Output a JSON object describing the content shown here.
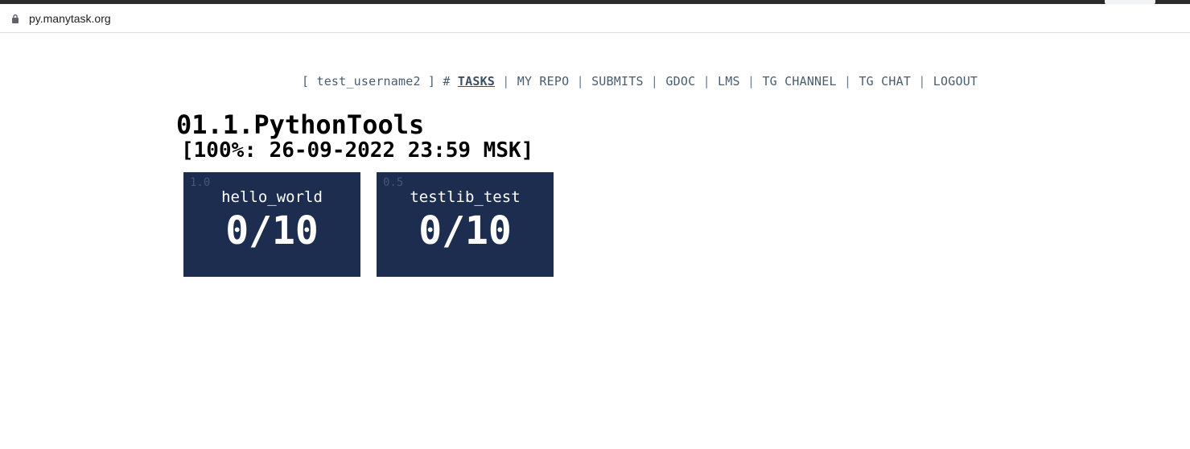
{
  "browser": {
    "url": "py.manytask.org"
  },
  "nav": {
    "user_prefix": "[ ",
    "username": "test_username2",
    "user_suffix": " ] #",
    "links": [
      {
        "label": "TASKS",
        "active": true
      },
      {
        "label": "MY REPO"
      },
      {
        "label": "SUBMITS"
      },
      {
        "label": "GDOC"
      },
      {
        "label": "LMS"
      },
      {
        "label": "TG CHANNEL"
      },
      {
        "label": "TG CHAT"
      },
      {
        "label": "LOGOUT"
      }
    ],
    "separator": "|"
  },
  "group": {
    "title": "01.1.PythonTools",
    "deadline": "[100%: 26-09-2022 23:59 MSK]"
  },
  "tasks": [
    {
      "weight": "1.0",
      "name": "hello_world",
      "score": "0/10"
    },
    {
      "weight": "0.5",
      "name": "testlib_test",
      "score": "0/10"
    }
  ],
  "colors": {
    "card_bg": "#1c2d4f",
    "nav_text": "#4a5d6e"
  },
  "icons": {
    "lock": "lock-icon"
  }
}
